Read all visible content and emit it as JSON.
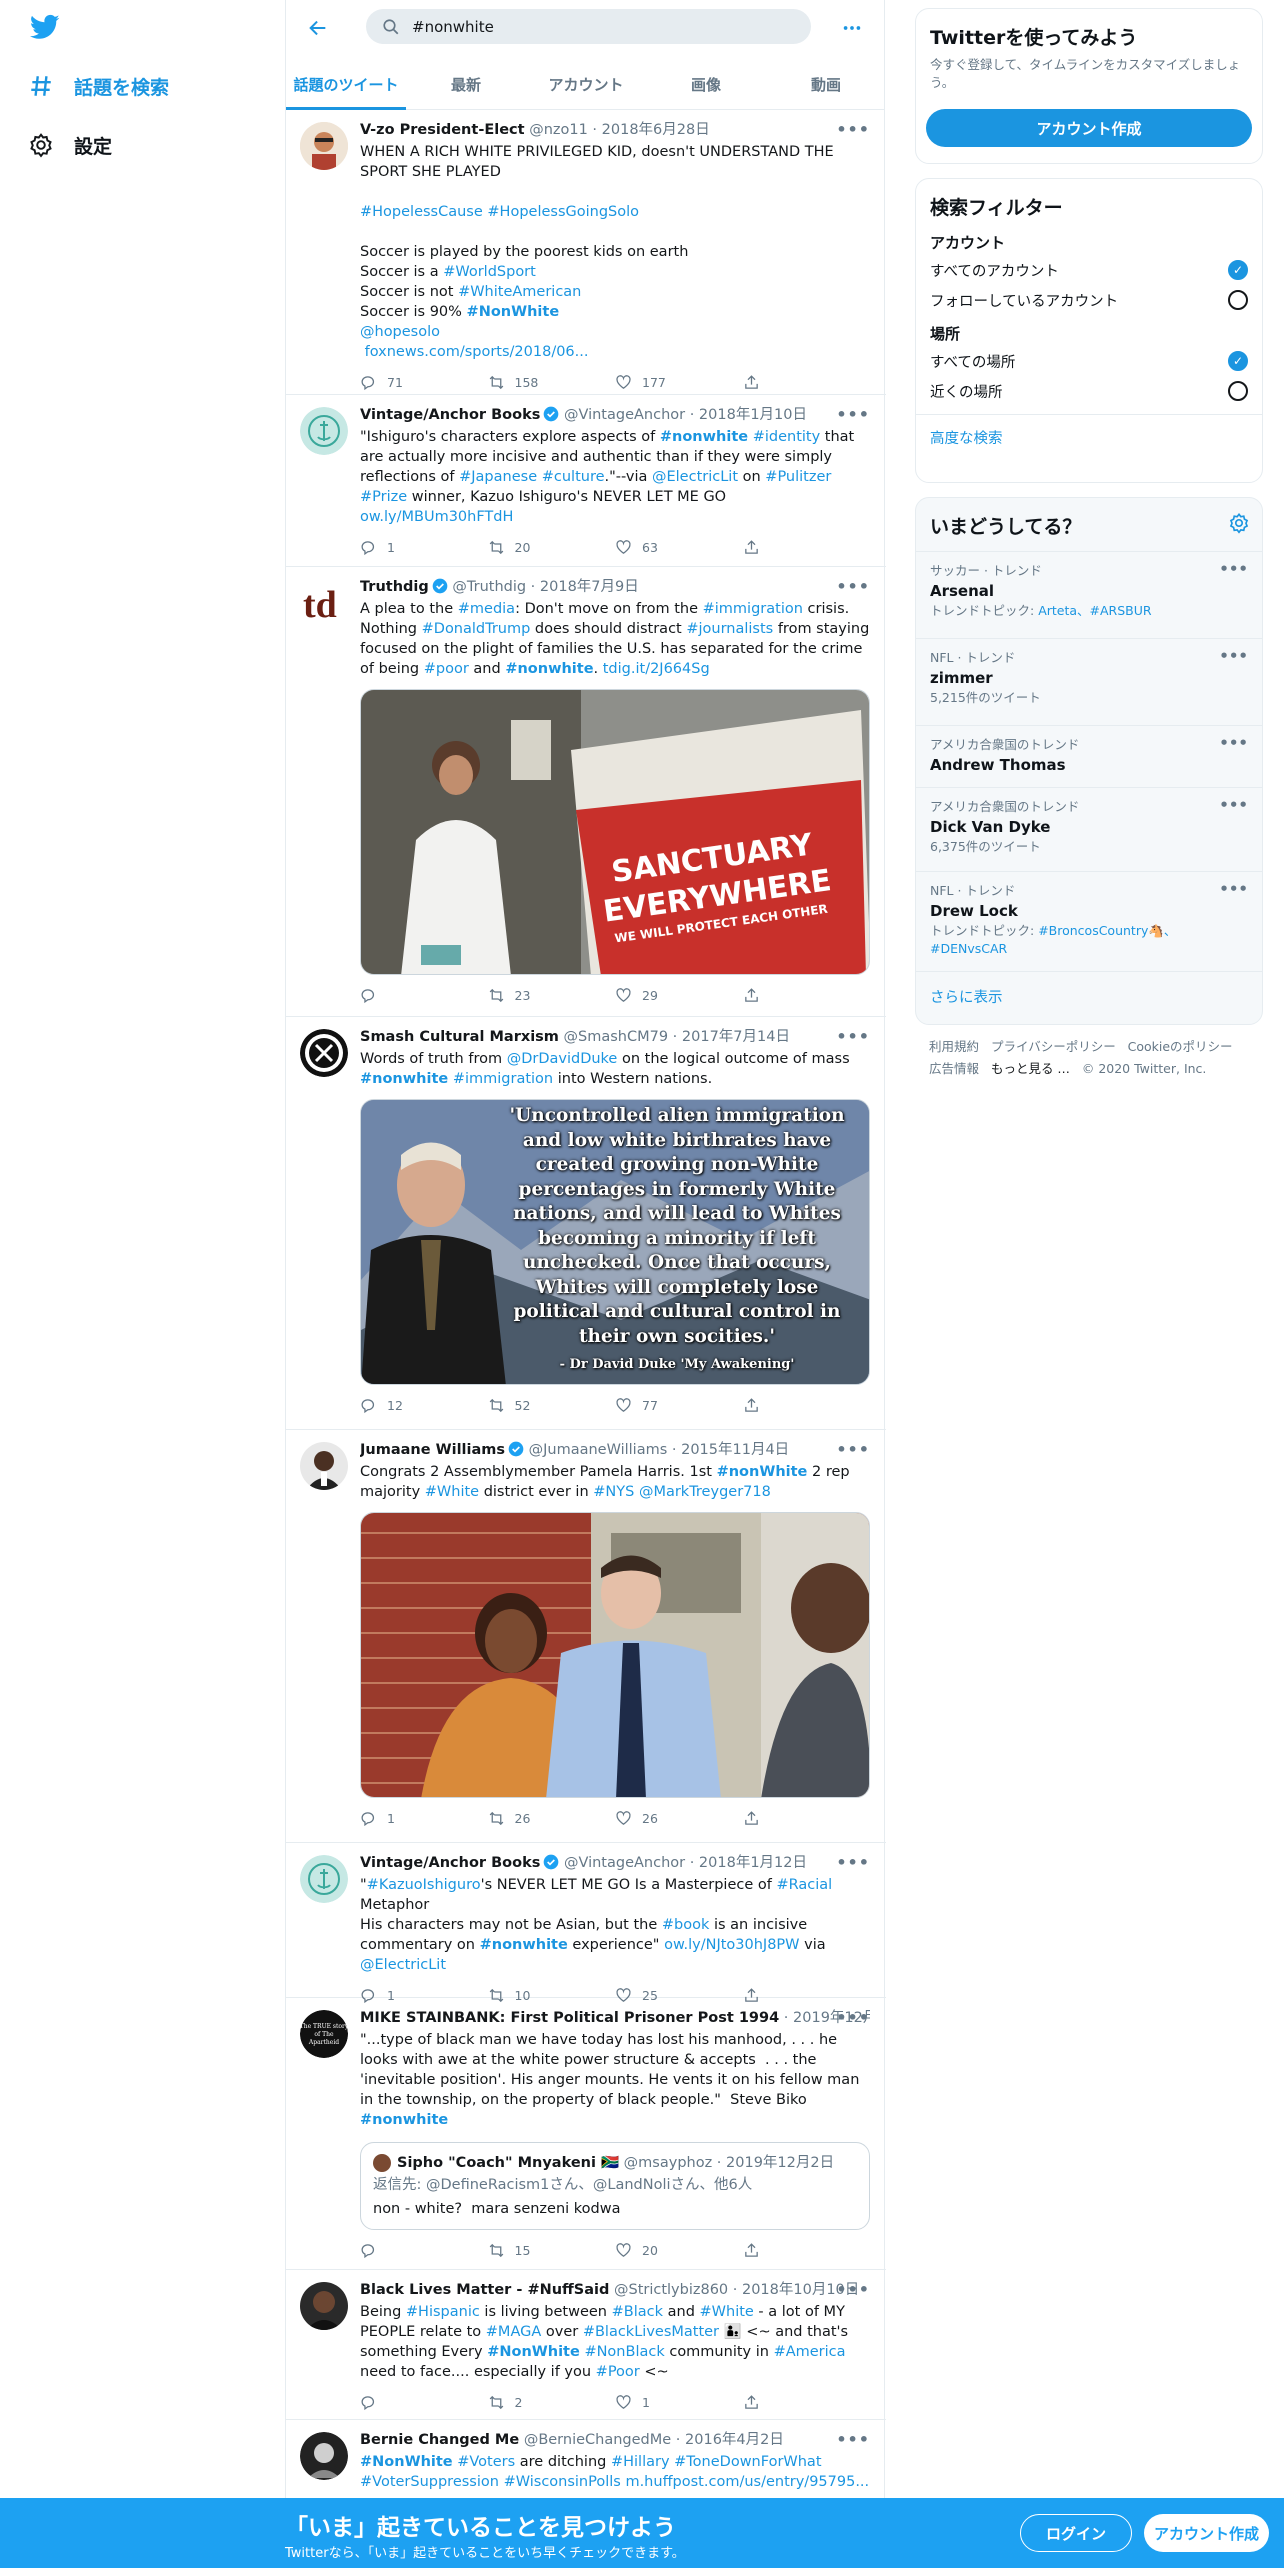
{
  "nav": {
    "explore": "話題を検索",
    "settings": "設定"
  },
  "search": {
    "value": "#nonwhite"
  },
  "tabs": [
    "話題のツイート",
    "最新",
    "アカウント",
    "画像",
    "動画"
  ],
  "tweets": [
    {
      "name": "V-zo President-Elect",
      "handle": "@nzo11",
      "date": "2018年6月28日",
      "text": [
        "WHEN A RICH WHITE PRIVILEGED KID, doesn't UNDERSTAND THE SPORT SHE PLAYED",
        "",
        "#HopelessCause #HopelessGoingSolo",
        "",
        "Soccer is played by the poorest kids on earth",
        "Soccer is a #WorldSport",
        "Soccer is not #WhiteAmerican",
        "Soccer is 90% #NonWhite",
        "@hopesolo",
        " foxnews.com/sports/2018/06..."
      ],
      "replies": "71",
      "retweets": "158",
      "likes": "177"
    },
    {
      "name": "Vintage/Anchor Books",
      "handle": "@VintageAnchor",
      "date": "2018年1月10日",
      "text": [
        "\"Ishiguro's characters explore aspects of #nonwhite #identity that are actually more incisive and authentic than if they were simply reflections of #Japanese #culture.\"--via @ElectricLit on #Pulitzer #Prize winner, Kazuo Ishiguro's NEVER LET ME GO",
        "ow.ly/MBUm30hFTdH"
      ],
      "replies": "1",
      "retweets": "20",
      "likes": "63"
    },
    {
      "name": "Truthdig",
      "handle": "@Truthdig",
      "date": "2018年7月9日",
      "text": [
        "A plea to the #media: Don't move on from the #immigration crisis. Nothing #DonaldTrump does should distract #journalists from staying focused on the plight of families the U.S. has separated for the crime of being #poor and #nonwhite. tdig.it/2J664Sg"
      ],
      "replies": "",
      "retweets": "23",
      "likes": "29",
      "media_text": [
        "SANCTUARY",
        "EVERYWHERE",
        "WE WILL PROTECT EACH OTHER"
      ]
    },
    {
      "name": "Smash Cultural Marxism",
      "handle": "@SmashCM79",
      "date": "2017年7月14日",
      "text": [
        "Words of truth from @DrDavidDuke on the logical outcome of mass #nonwhite #immigration into Western nations."
      ],
      "replies": "12",
      "retweets": "52",
      "likes": "77",
      "media_text": [
        "'Uncontrolled alien immigration",
        "and low white birthrates have",
        "created growing non-White",
        "percentages in formerly White",
        "nations, and will lead to Whites",
        "becoming a minority if left",
        "unchecked. Once that occurs,",
        "Whites will completely lose",
        "political and cultural control in",
        "their own socities.'",
        "- Dr David Duke 'My Awakening'"
      ]
    },
    {
      "name": "Jumaane Williams",
      "handle": "@JumaaneWilliams",
      "date": "2015年11月4日",
      "text": [
        "Congrats 2 Assemblymember Pamela Harris. 1st #nonWhite 2 rep majority #White district ever in #NYS @MarkTreyger718"
      ],
      "replies": "1",
      "retweets": "26",
      "likes": "26"
    },
    {
      "name": "Vintage/Anchor Books",
      "handle": "@VintageAnchor",
      "date": "2018年1月12日",
      "text": [
        "\"#KazuoIshiguro's NEVER LET ME GO Is a Masterpiece of #Racial Metaphor",
        "His characters may not be Asian, but the #book is an incisive commentary on #nonwhite experience\" ow.ly/NJto30hJ8PW via @ElectricLit"
      ],
      "replies": "1",
      "retweets": "10",
      "likes": "25"
    },
    {
      "name": "MIKE STAINBANK: First Political Prisoner Post 1994",
      "handle": "",
      "date": "2019年12月2日",
      "text": [
        "\"...type of black man we have today has lost his manhood, . . . he looks with awe at the white power structure & accepts  . . . the 'inevitable position'. His anger mounts. He vents it on his fellow man in the township, on the property of black people.\"  Steve Biko",
        "#nonwhite"
      ],
      "quote": {
        "name": "Sipho \"Coach\" Mnyakeni 🇿🇦",
        "handle": "@msayphoz",
        "date": "2019年12月2日",
        "reply": "返信先: @DefineRacism1さん、@LandNoliさん、他6人",
        "text": "non - white?  mara senzeni kodwa"
      },
      "replies": "",
      "retweets": "15",
      "likes": "20"
    },
    {
      "name": "Black Lives Matter - #NuffSaid",
      "handle": "@Strictlybiz860",
      "date": "2018年10月10日",
      "text": [
        "Being #Hispanic is living between #Black and #White - a lot of MY PEOPLE relate to #MAGA over #BlackLivesMatter 👨‍👦 <~ and that's something Every #NonWhite #NonBlack community in #America need to face.... especially if you #Poor <~"
      ],
      "replies": "",
      "retweets": "2",
      "likes": "1"
    },
    {
      "name": "Bernie Changed Me",
      "handle": "@BernieChangedMe",
      "date": "2016年4月2日",
      "text": [
        "#NonWhite #Voters are ditching #Hillary #ToneDownForWhat #VoterSuppression #WisconsinPolls m.huffpost.com/us/entry/95795..."
      ],
      "replies": "",
      "retweets": "",
      "likes": ""
    }
  ],
  "signup": {
    "title": "Twitterを使ってみよう",
    "desc": "今すぐ登録して、タイムラインをカスタマイズしましょう。",
    "button": "アカウント作成"
  },
  "filter": {
    "title": "検索フィルター",
    "account_h": "アカウント",
    "all_accounts": "すべてのアカウント",
    "following": "フォローしているアカウント",
    "place_h": "場所",
    "all_places": "すべての場所",
    "nearby": "近くの場所",
    "advanced": "高度な検索"
  },
  "trends": {
    "title": "いまどうしてる？",
    "items": [
      {
        "cat": "サッカー · トレンド",
        "name": "Arsenal",
        "sub_pre": "トレンドトピック: ",
        "sub_links": "Arteta、#ARSBUR"
      },
      {
        "cat": "NFL · トレンド",
        "name": "zimmer",
        "sub_pre": "5,215件のツイート",
        "sub_links": ""
      },
      {
        "cat": "アメリカ合衆国のトレンド",
        "name": "Andrew Thomas",
        "sub_pre": "",
        "sub_links": ""
      },
      {
        "cat": "アメリカ合衆国のトレンド",
        "name": "Dick Van Dyke",
        "sub_pre": "6,375件のツイート",
        "sub_links": ""
      },
      {
        "cat": "NFL · トレンド",
        "name": "Drew Lock",
        "sub_pre": "トレンドトピック: ",
        "sub_links": "#BroncosCountry🐴、#DENvsCAR"
      }
    ],
    "more": "さらに表示"
  },
  "footer_links": [
    "利用規約",
    "プライバシーポリシー",
    "Cookieのポリシー",
    "広告情報",
    "もっと見る …",
    "© 2020 Twitter, Inc."
  ],
  "bottom": {
    "title": "「いま」起きていることを見つけよう",
    "sub": "Twitterなら、「いま」起きていることをいち早くチェックできます。",
    "login": "ログイン",
    "signup": "アカウント作成"
  },
  "colors": {
    "accent": "#1b95e0",
    "bar": "#1da1f2",
    "muted": "#657786"
  }
}
